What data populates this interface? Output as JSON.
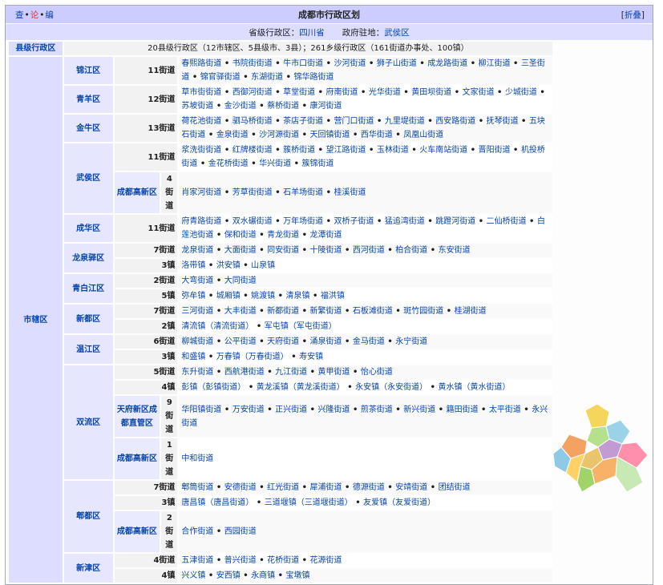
{
  "header": {
    "vde": [
      "查",
      "论",
      "编"
    ],
    "title": "成都市行政区划",
    "collapse_open": "[",
    "collapse_label": "折叠",
    "collapse_close": "]"
  },
  "info": {
    "province_label": "省级行政区：",
    "province": "四川省",
    "seat_label": "政府驻地：",
    "seat": "武侯区"
  },
  "county_level": {
    "label": "县级行政区",
    "summary_a": "20县级行政区（12市辖区、5县级市、3县）；261乡级行政区（161街道办事处、100镇）"
  },
  "main_group": "市辖区",
  "districts": [
    {
      "name": "锦江区",
      "rows": [
        {
          "count": "11街道",
          "items": [
            "春熙路街道",
            "书院街街道",
            "牛市口街道",
            "沙河街道",
            "狮子山街道",
            "成龙路街道",
            "柳江街道",
            "三圣街道",
            "锦官驿街道",
            "东湖街道",
            "锦华路街道"
          ]
        }
      ]
    },
    {
      "name": "青羊区",
      "rows": [
        {
          "count": "12街道",
          "items": [
            "草市街街道",
            "西御河街道",
            "草堂街道",
            "府南街道",
            "光华街道",
            "黄田坝街道",
            "文家街道",
            "少城街道",
            "苏坡街道",
            "金沙街道",
            "蔡桥街道",
            "康河街道"
          ]
        }
      ]
    },
    {
      "name": "金牛区",
      "rows": [
        {
          "count": "13街道",
          "items": [
            "荷花池街道",
            "驷马桥街道",
            "茶店子街道",
            "营门口街道",
            "九里堤街道",
            "西安路街道",
            "抚琴街道",
            "五块石街道",
            "金泉街道",
            "沙河源街道",
            "天回镇街道",
            "西华街道",
            "凤凰山街道"
          ]
        }
      ]
    },
    {
      "name": "武侯区",
      "rows": [
        {
          "count": "11街道",
          "items": [
            "浆洗街街道",
            "红牌楼街道",
            "簇桥街道",
            "望江路街道",
            "玉林街道",
            "火车南站街道",
            "晋阳街道",
            "机投桥街道",
            "金花桥街道",
            "华兴街道",
            "簇锦街道"
          ]
        },
        {
          "sub": "成都高新区",
          "count": "4街道",
          "items": [
            "肖家河街道",
            "芳草街街道",
            "石羊场街道",
            "桂溪街道"
          ]
        }
      ]
    },
    {
      "name": "成华区",
      "rows": [
        {
          "count": "11街道",
          "items": [
            "府青路街道",
            "双水碾街道",
            "万年场街道",
            "双桥子街道",
            "猛追湾街道",
            "跳蹬河街道",
            "二仙桥街道",
            "白莲池街道",
            "保和街道",
            "青龙街道",
            "龙潭街道"
          ]
        }
      ]
    },
    {
      "name": "龙泉驿区",
      "rows": [
        {
          "count": "7街道",
          "items": [
            "龙泉街道",
            "大面街道",
            "同安街道",
            "十陵街道",
            "西河街道",
            "柏合街道",
            "东安街道"
          ]
        },
        {
          "count": "3镇",
          "items": [
            "洛带镇",
            "洪安镇",
            "山泉镇"
          ]
        }
      ]
    },
    {
      "name": "青白江区",
      "rows": [
        {
          "count": "2街道",
          "items": [
            "大弯街道",
            "大同街道"
          ]
        },
        {
          "count": "5镇",
          "items": [
            "弥牟镇",
            "城厢镇",
            "姚渡镇",
            "清泉镇",
            "福洪镇"
          ]
        }
      ]
    },
    {
      "name": "新都区",
      "rows": [
        {
          "count": "7街道",
          "items": [
            "三河街道",
            "大丰街道",
            "新都街道",
            "新繁街道",
            "石板滩街道",
            "斑竹园街道",
            "桂湖街道"
          ]
        },
        {
          "count": "2镇",
          "items": [
            "清流镇（清流街道）",
            "军屯镇（军屯街道）"
          ]
        }
      ]
    },
    {
      "name": "温江区",
      "rows": [
        {
          "count": "6街道",
          "items": [
            "柳城街道",
            "公平街道",
            "天府街道",
            "涌泉街道",
            "金马街道",
            "永宁街道"
          ]
        },
        {
          "count": "3镇",
          "items": [
            "和盛镇",
            "万春镇（万春街道）",
            "寿安镇"
          ]
        }
      ]
    },
    {
      "name": "双流区",
      "rows": [
        {
          "count": "5街道",
          "items": [
            "东升街道",
            "西航港街道",
            "九江街道",
            "黄甲街道",
            "怡心街道"
          ]
        },
        {
          "count": "4镇",
          "items": [
            "彭镇（彭镇街道）",
            "黄龙溪镇（黄龙溪街道）",
            "永安镇（永安街道）",
            "黄水镇（黄水街道）"
          ]
        },
        {
          "sub": "天府新区成都直管区",
          "count": "9街道",
          "items": [
            "华阳镇街道",
            "万安街道",
            "正兴街道",
            "兴隆街道",
            "煎茶街道",
            "新兴街道",
            "籍田街道",
            "太平街道",
            "永兴街道"
          ]
        },
        {
          "sub": "成都高新区",
          "count": "1街道",
          "items": [
            "中和街道"
          ]
        }
      ]
    },
    {
      "name": "郫都区",
      "rows": [
        {
          "count": "7街道",
          "items": [
            "郫筒街道",
            "安德街道",
            "红光街道",
            "犀浦街道",
            "德源街道",
            "安靖街道",
            "团结街道"
          ]
        },
        {
          "count": "3镇",
          "items": [
            "唐昌镇（唐昌街道）",
            "三道堰镇（三道堰街道）",
            "友爱镇（友爱街道）"
          ]
        },
        {
          "sub": "成都高新区",
          "count": "2街道",
          "items": [
            "合作街道",
            "西园街道"
          ]
        }
      ]
    },
    {
      "name": "新津区",
      "rows": [
        {
          "count": "4街道",
          "items": [
            "五津街道",
            "普兴街道",
            "花桥街道",
            "花源街道"
          ]
        },
        {
          "count": "4镇",
          "items": [
            "兴义镇",
            "安西镇",
            "永商镇",
            "宝墩镇"
          ]
        }
      ]
    }
  ],
  "map": {
    "colors": [
      "#f6d55c",
      "#9ad3e8",
      "#b5e08c",
      "#f4a261",
      "#e9c46a",
      "#c39bd3",
      "#ff8fab",
      "#8ecae6",
      "#ffd166",
      "#a0d468",
      "#f7b267",
      "#c7e9b4"
    ]
  }
}
